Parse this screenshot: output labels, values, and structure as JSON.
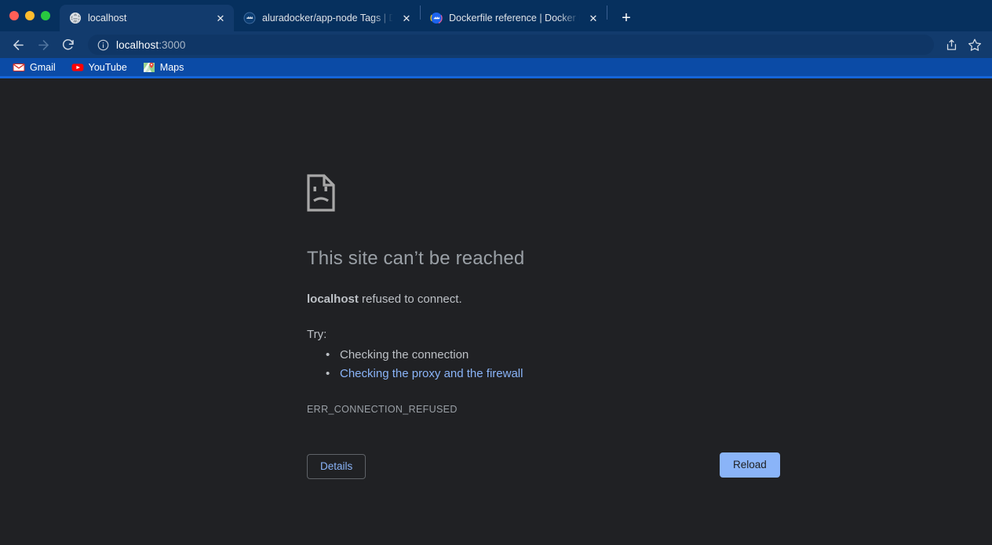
{
  "window": {
    "traffic_lights": [
      {
        "name": "close",
        "color": "#ff5f57"
      },
      {
        "name": "minimize",
        "color": "#ffbd2e"
      },
      {
        "name": "maximize",
        "color": "#28c940"
      }
    ]
  },
  "tabstrip": {
    "tabs": [
      {
        "title": "localhost",
        "favicon": "globe-icon",
        "active": true,
        "close_label": "✕"
      },
      {
        "title": "aluradocker/app-node Tags | D",
        "favicon": "docker-hub-icon",
        "active": false,
        "close_label": "✕"
      },
      {
        "title": "Dockerfile reference | Docker D",
        "favicon": "docker-docs-icon",
        "active": false,
        "close_label": "✕"
      }
    ],
    "new_tab_label": "+"
  },
  "toolbar": {
    "back_label": "←",
    "forward_label": "→",
    "reload_label": "↻",
    "site_info_icon": "info-circle-icon",
    "url_host": "localhost",
    "url_rest": ":3000",
    "url_full": "localhost:3000",
    "share_icon": "share-icon",
    "bookmark_icon": "star-icon"
  },
  "bookmarks": {
    "items": [
      {
        "label": "Gmail",
        "icon": "gmail-icon"
      },
      {
        "label": "YouTube",
        "icon": "youtube-icon"
      },
      {
        "label": "Maps",
        "icon": "google-maps-icon"
      }
    ]
  },
  "error_page": {
    "icon": "sad-document-icon",
    "title": "This site can’t be reached",
    "summary_host": "localhost",
    "summary_rest": " refused to connect.",
    "try_label": "Try:",
    "suggestions": [
      {
        "text": "Checking the connection",
        "is_link": false
      },
      {
        "text": "Checking the proxy and the firewall",
        "is_link": true
      }
    ],
    "error_code": "ERR_CONNECTION_REFUSED",
    "details_button": "Details",
    "reload_button": "Reload"
  },
  "colors": {
    "tabstrip_bg": "#06305e",
    "toolbar_bg": "#123b6d",
    "bookmarks_bg": "#0b4ba6",
    "bookmarks_border": "#1565d8",
    "page_bg": "#202124",
    "accent_blue": "#8ab4f8",
    "body_text": "#bdc1c6",
    "muted_text": "#9aa0a6"
  }
}
